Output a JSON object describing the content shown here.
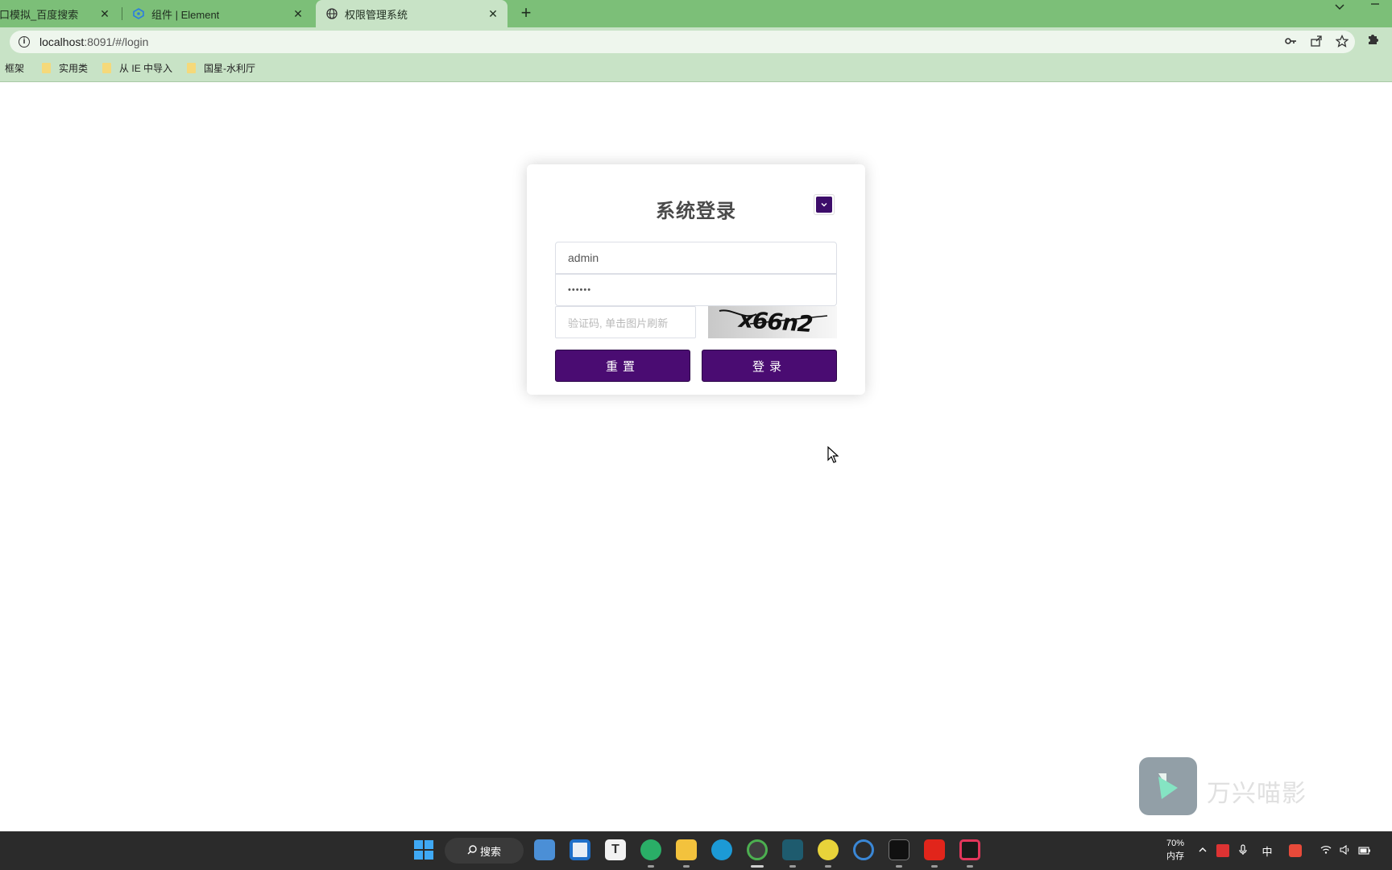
{
  "browser": {
    "tabs": [
      {
        "title": "接口模拟_百度搜索"
      },
      {
        "title": "组件 | Element"
      },
      {
        "title": "权限管理系统",
        "active": true
      }
    ],
    "new_tab": "+",
    "close_glyph": "✕",
    "url_host": "localhost",
    "url_rest": ":8091/#/login",
    "bookmarks": [
      "框架",
      "实用类",
      "从 IE 中导入",
      "国星-水利厅"
    ]
  },
  "login": {
    "title": "系统登录",
    "username_value": "admin",
    "password_value": "••••••",
    "captcha_placeholder": "验证码, 单击图片刷新",
    "captcha_text": "x66n2",
    "reset_label": "重置",
    "login_label": "登录"
  },
  "watermark": {
    "text": "万兴喵影"
  },
  "taskbar": {
    "search_label": "搜索",
    "memory_percent": "70%",
    "memory_label": "内存",
    "ime_label": "中"
  },
  "colors": {
    "tab_bar": "#7cbf78",
    "toolbar": "#c8e3c6",
    "button_primary": "#4a0c72",
    "taskbar": "#2b2b2b"
  }
}
